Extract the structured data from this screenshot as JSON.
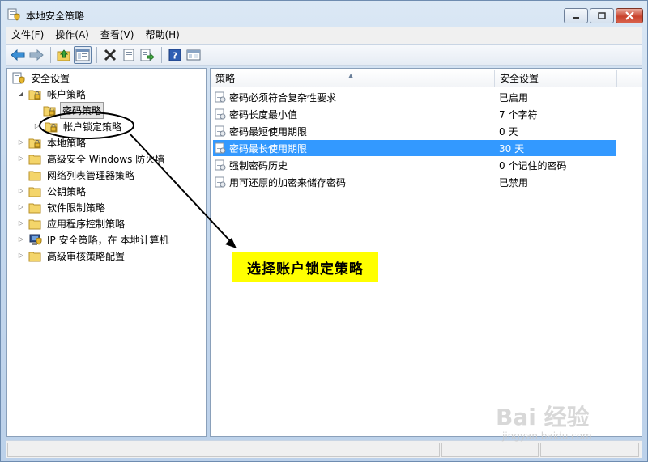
{
  "window": {
    "title": "本地安全策略"
  },
  "menu": [
    "文件(F)",
    "操作(A)",
    "查看(V)",
    "帮助(H)"
  ],
  "toolbar": [
    "back-icon",
    "forward-icon",
    "up-folder-icon",
    "show-hide-tree-icon",
    "delete-icon",
    "properties-icon",
    "export-list-icon",
    "help-icon",
    "view-icon"
  ],
  "tree": [
    {
      "label": "安全设置",
      "level": 0,
      "expand": ""
    },
    {
      "label": "帐户策略",
      "level": 1,
      "expand": "open"
    },
    {
      "label": "密码策略",
      "level": 2,
      "expand": "",
      "selected": true
    },
    {
      "label": "帐户锁定策略",
      "level": 2,
      "expand": "closed"
    },
    {
      "label": "本地策略",
      "level": 1,
      "expand": "closed"
    },
    {
      "label": "高级安全 Windows 防火墙",
      "level": 1,
      "expand": "closed"
    },
    {
      "label": "网络列表管理器策略",
      "level": 1,
      "expand": ""
    },
    {
      "label": "公钥策略",
      "level": 1,
      "expand": "closed"
    },
    {
      "label": "软件限制策略",
      "level": 1,
      "expand": "closed"
    },
    {
      "label": "应用程序控制策略",
      "level": 1,
      "expand": "closed"
    },
    {
      "label": "IP 安全策略，在 本地计算机",
      "level": 1,
      "expand": "closed"
    },
    {
      "label": "高级审核策略配置",
      "level": 1,
      "expand": "closed"
    }
  ],
  "list": {
    "columns": [
      "策略",
      "安全设置"
    ],
    "rows": [
      {
        "policy": "密码必须符合复杂性要求",
        "setting": "已启用"
      },
      {
        "policy": "密码长度最小值",
        "setting": "7 个字符"
      },
      {
        "policy": "密码最短使用期限",
        "setting": "0 天"
      },
      {
        "policy": "密码最长使用期限",
        "setting": "30 天",
        "selected": true
      },
      {
        "policy": "强制密码历史",
        "setting": "0 个记住的密码"
      },
      {
        "policy": "用可还原的加密来储存密码",
        "setting": "已禁用"
      }
    ]
  },
  "annotation": {
    "callout": "选择账户锁定策略"
  },
  "watermark": {
    "logo": "Bai 经验",
    "site": "jingyan.baidu.com"
  },
  "colors": {
    "selection": "#3399ff",
    "callout": "#ffff00"
  }
}
